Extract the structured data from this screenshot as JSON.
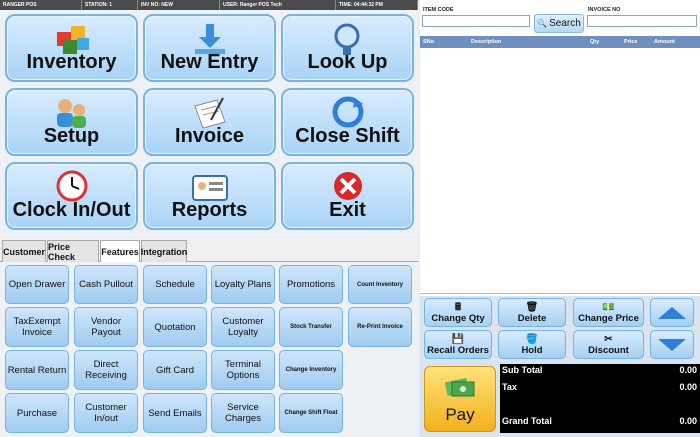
{
  "status_bar": {
    "app": "RANGER POS",
    "station": "STATION: 1",
    "invoice": "INV NO: NEW",
    "user": "USER: Ranger POS Tech",
    "time": "TIME: 04:44:32 PM"
  },
  "big_buttons": {
    "inventory": "Inventory",
    "new_entry": "New Entry",
    "look_up": "Look Up",
    "setup": "Setup",
    "invoice": "Invoice",
    "close_shift": "Close Shift",
    "clock": "Clock In/Out",
    "reports": "Reports",
    "exit": "Exit"
  },
  "tabs": [
    "Customer",
    "Price Check",
    "Features",
    "Integration"
  ],
  "active_tab": "Features",
  "feature_buttons": {
    "open_drawer": "Open Drawer",
    "cash_pullout": "Cash Pullout",
    "schedule": "Schedule",
    "loyalty_plans": "Loyalty Plans",
    "promotions": "Promotions",
    "count_inventory": "Count Inventory",
    "taxexempt_invoice": "TaxExempt Invoice",
    "vendor_payout": "Vendor Payout",
    "quotation": "Quotation",
    "customer_loyalty": "Customer Loyalty",
    "stock_transfer": "Stock Transfer",
    "reprint_invoice": "Re-Print Invoice",
    "rental_return": "Rental Return",
    "direct_receiving": "Direct Receiving",
    "gift_card": "Gift Card",
    "terminal_options": "Terminal Options",
    "change_inventory": "Change Inventory",
    "purchase": "Purchase",
    "customer_inout": "Customer In/out",
    "send_emails": "Send Emails",
    "service_charges": "Service Charges",
    "change_shift_float": "Change Shift Float"
  },
  "search": {
    "item_code_label": "ITEM CODE",
    "invoice_no_label": "INVOICE NO",
    "item_code_value": "",
    "invoice_no_value": "",
    "search_label": "Search"
  },
  "grid": {
    "columns": [
      "SNo",
      "Description",
      "Qty",
      "Price",
      "Amount"
    ]
  },
  "actions": {
    "change_qty": "Change Qty",
    "delete": "Delete",
    "change_price": "Change Price",
    "recall_orders": "Recall Orders",
    "hold": "Hold",
    "discount": "Discount",
    "pay": "Pay"
  },
  "totals": {
    "sub_total_label": "Sub Total",
    "sub_total": "0.00",
    "tax_label": "Tax",
    "tax": "0.00",
    "grand_total_label": "Grand Total",
    "grand_total": "0.00"
  },
  "colors": {
    "button_blue": "#a9d3f5",
    "header_blue": "#6e8fbf",
    "pay_yellow": "#f2b11c",
    "arrow_blue": "#2f7fd8"
  },
  "icons": {
    "inventory": "boxes-icon",
    "new_entry": "download-arrow-icon",
    "look_up": "magnifier-icon",
    "setup": "people-gear-icon",
    "invoice": "paper-pen-icon",
    "close_shift": "refresh-icon",
    "clock": "clock-icon",
    "reports": "id-card-icon",
    "exit": "red-x-icon"
  }
}
